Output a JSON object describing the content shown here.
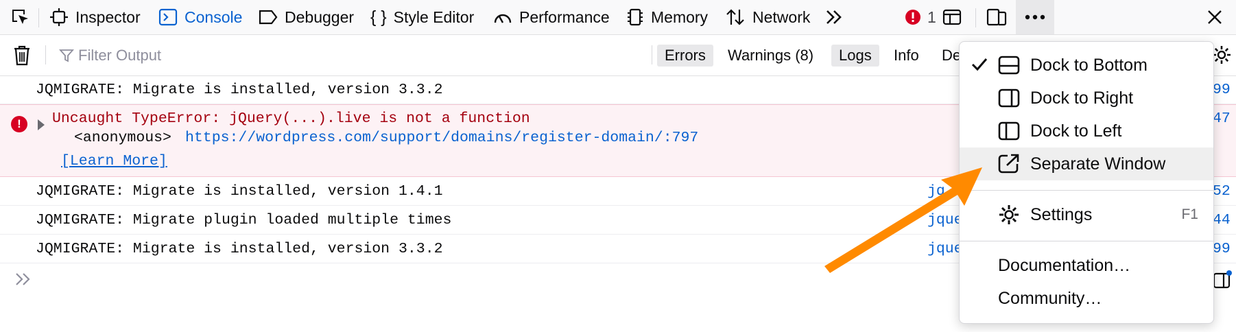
{
  "toolbar": {
    "tabs": [
      {
        "label": "Inspector",
        "icon": "inspector-icon"
      },
      {
        "label": "Console",
        "icon": "console-icon",
        "active": true
      },
      {
        "label": "Debugger",
        "icon": "debugger-icon"
      },
      {
        "label": "Style Editor",
        "icon": "style-editor-icon"
      },
      {
        "label": "Performance",
        "icon": "performance-icon"
      },
      {
        "label": "Memory",
        "icon": "memory-icon"
      },
      {
        "label": "Network",
        "icon": "network-icon"
      }
    ],
    "error_count": "1",
    "colors": {
      "active": "#0a62d0",
      "error": "#d70022",
      "arrow": "#ff8a00"
    }
  },
  "filterbar": {
    "placeholder": "Filter Output",
    "buttons": [
      "Errors",
      "Warnings (8)",
      "Logs",
      "Info",
      "De"
    ]
  },
  "logs": [
    {
      "text": "JQMIGRATE: Migrate is installed, version 3.3.2",
      "source": "99"
    },
    {
      "text": "Uncaught TypeError: jQuery(...).live is not a function",
      "source": "47",
      "stack_fn": "<anonymous>",
      "stack_url": "https://wordpress.com/support/domains/register-domain/:797",
      "learn_more": "[Learn More]"
    },
    {
      "text": "JQMIGRATE: Migrate is installed, version 1.4.1",
      "source": "jq",
      "source_end": "52"
    },
    {
      "text": "JQMIGRATE: Migrate plugin loaded multiple times",
      "source": "jque",
      "source_end": "44"
    },
    {
      "text": "JQMIGRATE: Migrate is installed, version 3.3.2",
      "source": "jque",
      "source_end": "99"
    }
  ],
  "menu": {
    "items": [
      {
        "label": "Dock to Bottom",
        "icon": "dock-bottom-icon",
        "checked": true
      },
      {
        "label": "Dock to Right",
        "icon": "dock-right-icon"
      },
      {
        "label": "Dock to Left",
        "icon": "dock-left-icon"
      },
      {
        "label": "Separate Window",
        "icon": "separate-window-icon",
        "hover": true
      },
      {
        "label": "Settings",
        "icon": "gear-icon",
        "shortcut": "F1"
      },
      {
        "label": "Documentation…"
      },
      {
        "label": "Community…"
      }
    ]
  }
}
